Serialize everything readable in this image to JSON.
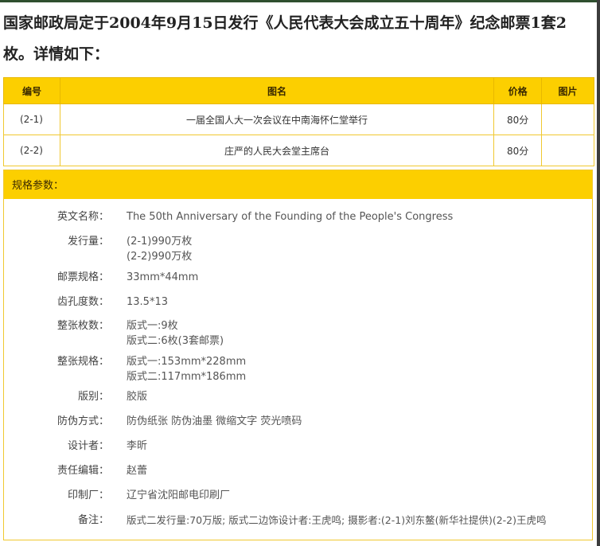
{
  "headline": "国家邮政局定于2004年9月15日发行《人民代表大会成立五十周年》纪念邮票1套2枚。详情如下：",
  "stamps_table": {
    "headers": [
      "编号",
      "图名",
      "价格",
      "图片"
    ],
    "rows": [
      {
        "code": "(2-1)",
        "name": "一届全国人大一次会议在中南海怀仁堂举行",
        "price": "80分",
        "image": ""
      },
      {
        "code": "(2-2)",
        "name": "庄严的人民大会堂主席台",
        "price": "80分",
        "image": ""
      }
    ]
  },
  "specs": {
    "title": "规格参数：",
    "items": [
      {
        "label": "英文名称：",
        "lines": [
          "The 50th Anniversary of the Founding of the People's Congress"
        ]
      },
      {
        "label": "发行量：",
        "lines": [
          "(2-1)990万枚",
          "(2-2)990万枚"
        ]
      },
      {
        "label": "邮票规格：",
        "lines": [
          "33mm*44mm"
        ]
      },
      {
        "label": "齿孔度数：",
        "lines": [
          "13.5*13"
        ]
      },
      {
        "label": "整张枚数：",
        "lines": [
          "版式一:9枚",
          "版式二:6枚(3套邮票)"
        ]
      },
      {
        "label": "整张规格：",
        "lines": [
          "版式一:153mm*228mm",
          "版式二:117mm*186mm"
        ]
      },
      {
        "label": "版别：",
        "lines": [
          "胶版"
        ]
      },
      {
        "label": "防伪方式：",
        "lines": [
          "防伪纸张 防伪油墨 微缩文字 荧光喷码"
        ]
      },
      {
        "label": "设计者：",
        "lines": [
          "李昕"
        ]
      },
      {
        "label": "责任编辑：",
        "lines": [
          "赵蕾"
        ]
      },
      {
        "label": "印制厂：",
        "lines": [
          "辽宁省沈阳邮电印刷厂"
        ]
      },
      {
        "label": "备注：",
        "lines": [
          "版式二发行量:70万版; 版式二边饰设计者:王虎鸣; 摄影者:(2-1)刘东鳌(新华社提供)(2-2)王虎鸣"
        ]
      }
    ]
  }
}
